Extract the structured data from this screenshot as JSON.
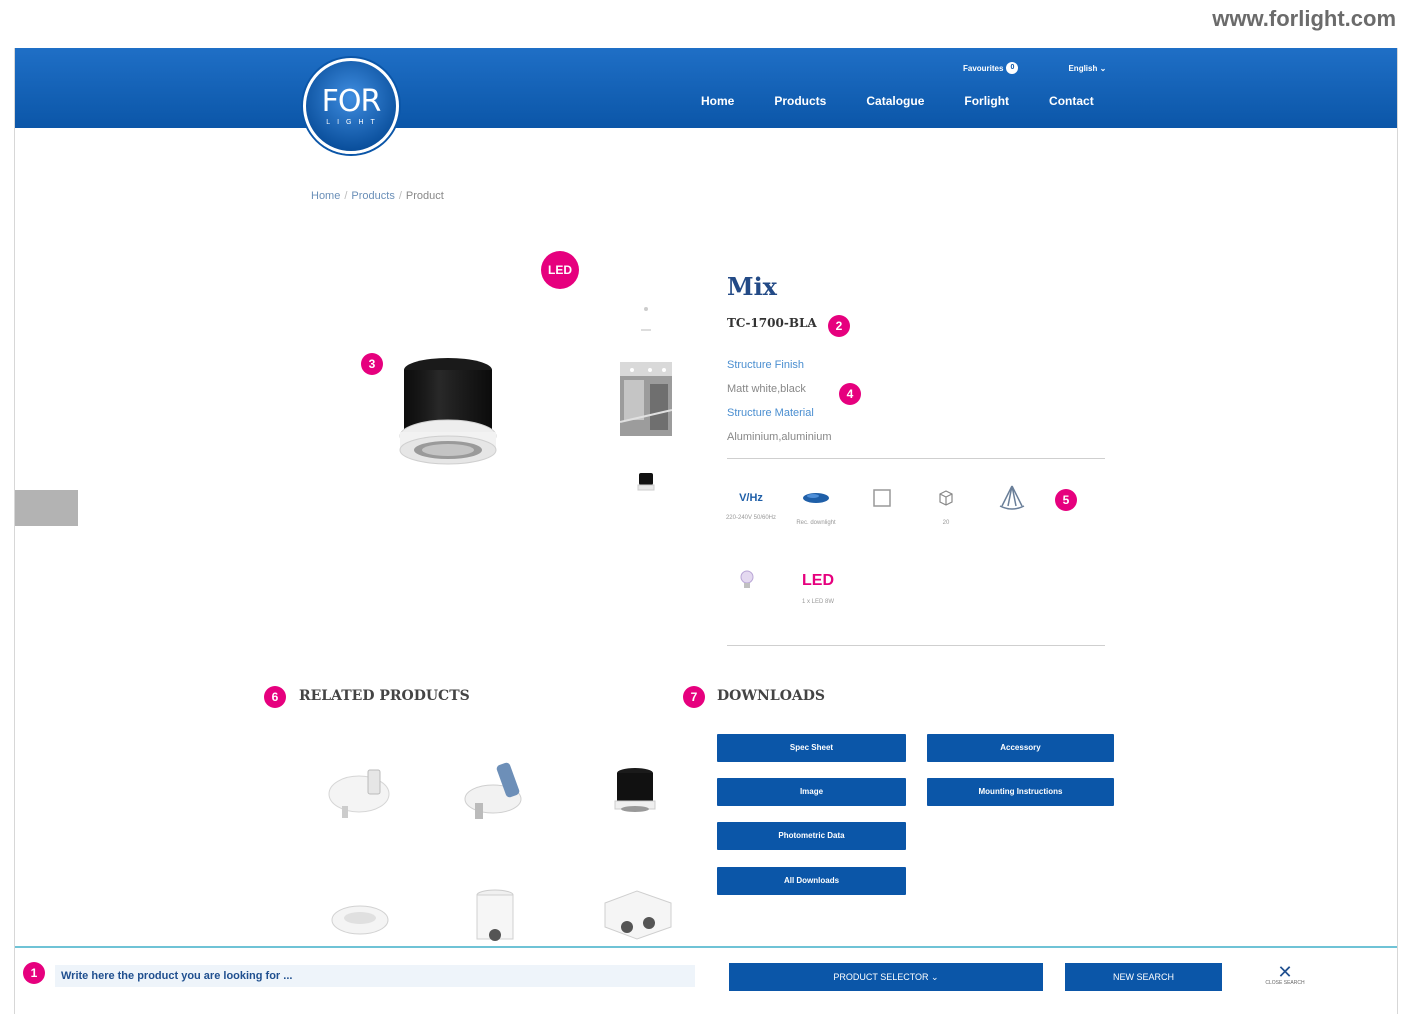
{
  "site_url": "www.forlight.com",
  "header": {
    "logo_main": "FOR",
    "logo_sub": "LIGHT",
    "favourites_label": "Favourites",
    "favourites_count": "0",
    "language": "English ⌄",
    "nav": [
      "Home",
      "Products",
      "Catalogue",
      "Forlight",
      "Contact"
    ]
  },
  "breadcrumb": {
    "home": "Home",
    "products": "Products",
    "current": "Product"
  },
  "badges": [
    "1",
    "2",
    "3",
    "4",
    "5",
    "6",
    "7"
  ],
  "led_circle": "LED",
  "product": {
    "name": "Mix",
    "code": "TC-1700-BLA",
    "specs": [
      {
        "label": "Structure Finish",
        "value": "Matt white,black"
      },
      {
        "label": "Structure Material",
        "value": "Aluminium,aluminium"
      }
    ]
  },
  "feature_icons": [
    {
      "icon": "voltage-icon",
      "text": "V/Hz",
      "caption": "220-240V 50/60Hz"
    },
    {
      "icon": "fixture-type-icon",
      "text": "",
      "caption": "Rec. downlight"
    },
    {
      "icon": "square-frame-icon",
      "text": "",
      "caption": ""
    },
    {
      "icon": "box-icon",
      "text": "",
      "caption": "20"
    },
    {
      "icon": "light-beam-icon",
      "text": "",
      "caption": ""
    },
    {
      "icon": "bulb-icon",
      "text": "",
      "caption": ""
    },
    {
      "icon": "led-icon",
      "text": "LED",
      "caption": "1 x LED 8W"
    }
  ],
  "related_products": {
    "title": "RELATED PRODUCTS",
    "items": [
      "recessed-spot-white",
      "adjustable-spot",
      "surface-cylinder-black",
      "recessed-round-white",
      "surface-cylinder-white",
      "twin-surface-box"
    ]
  },
  "downloads": {
    "title": "DOWNLOADS",
    "buttons": [
      "Spec Sheet",
      "Accessory",
      "Image",
      "Mounting Instructions",
      "Photometric Data",
      "All Downloads"
    ]
  },
  "bottom_bar": {
    "search_placeholder": "Write here the product you are looking for ...",
    "product_selector": "PRODUCT SELECTOR ⌄",
    "new_search": "NEW SEARCH",
    "close_caption": "CLOSE SEARCH"
  },
  "colors": {
    "brand_blue": "#0b56a8",
    "accent_magenta": "#e6007e",
    "title_blue": "#234a86"
  }
}
